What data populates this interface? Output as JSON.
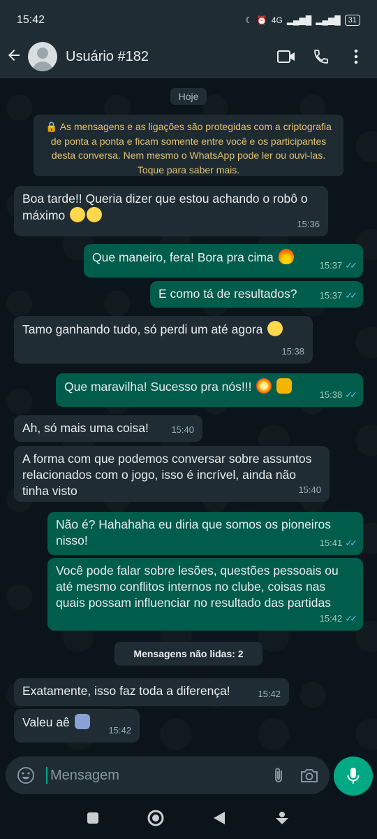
{
  "status_bar": {
    "time": "15:42",
    "network": "4G",
    "battery": "31"
  },
  "header": {
    "contact_name": "Usuário #182"
  },
  "chat": {
    "date_chip": "Hoje",
    "encryption_notice": "🔒 As mensagens e as ligações são protegidas com a criptografia de ponta a ponta e ficam somente entre você e os participantes desta conversa. Nem mesmo o WhatsApp pode ler ou ouvi-las. Toque para saber mais.",
    "unread_label": "Mensagens não lidas: 2",
    "messages": [
      {
        "text": "Boa tarde!! Queria dizer que estou achando o robô o máximo",
        "time": "15:36"
      },
      {
        "text": "Que maneiro, fera! Bora pra cima",
        "time": "15:37"
      },
      {
        "text": "E como tá de resultados?",
        "time": "15:37"
      },
      {
        "text": "Tamo ganhando tudo, só perdi um até agora",
        "time": "15:38"
      },
      {
        "text": "Que maravilha! Sucesso pra nós!!!",
        "time": "15:38"
      },
      {
        "text": "Ah, só mais uma coisa!",
        "time": "15:40"
      },
      {
        "text": "A forma com que podemos conversar sobre assuntos relacionados com o jogo, isso é incrível, ainda não tinha visto",
        "time": "15:40"
      },
      {
        "text": "Não é? Hahahaha eu diria que somos os pioneiros nisso!",
        "time": "15:41"
      },
      {
        "text": "Você pode falar sobre lesões, questões pessoais ou até mesmo conflitos internos no clube, coisas nas quais possam influenciar no resultado das partidas",
        "time": "15:42"
      },
      {
        "text": "Exatamente, isso faz toda a diferença!",
        "time": "15:42"
      },
      {
        "text": "Valeu aê",
        "time": "15:42"
      }
    ]
  },
  "composer": {
    "placeholder": "Mensagem"
  },
  "colors": {
    "accent": "#00a884",
    "outgoing": "#005c4b",
    "incoming": "#1f2c34",
    "read_ticks": "#53bdeb"
  }
}
